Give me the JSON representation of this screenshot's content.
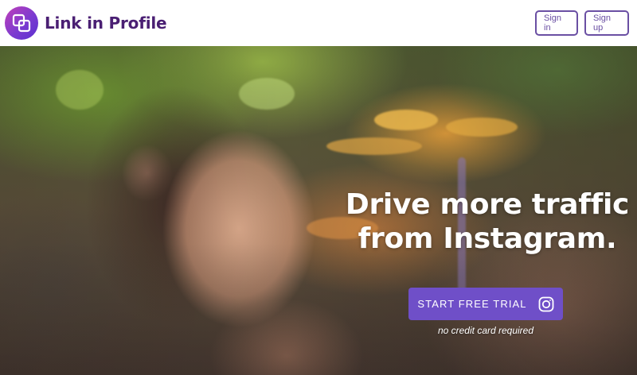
{
  "brand": {
    "name": "Link in Profile",
    "accent": "#4a1f73",
    "logo_gradient": [
      "#c13fb8",
      "#5a2fd0"
    ]
  },
  "header": {
    "signin_label": "Sign in",
    "signup_label": "Sign up",
    "button_color": "#6a4fa3"
  },
  "hero": {
    "headline_line1": "Drive more traffic",
    "headline_line2": "from Instagram.",
    "cta_label": "START FREE TRIAL",
    "cta_icon": "instagram-icon",
    "cta_color": "#6f4fc8",
    "note": "no credit card required"
  }
}
